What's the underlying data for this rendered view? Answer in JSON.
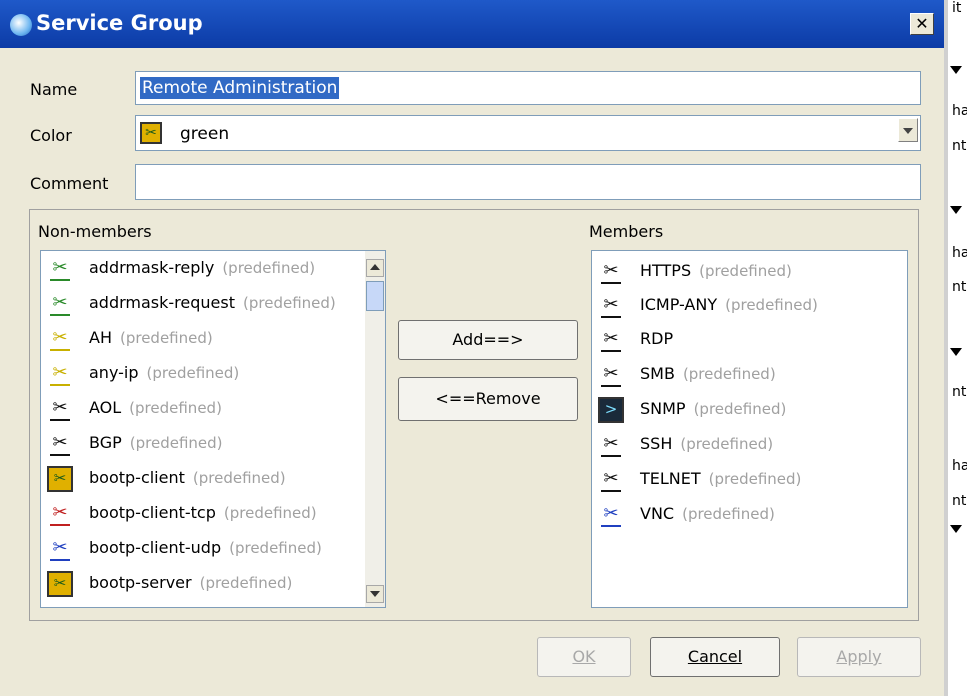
{
  "dialog": {
    "title": "Service Group",
    "close_label": "✕",
    "name_label": "Name",
    "name_value": "Remote Administration",
    "color_label": "Color",
    "color_value": "green",
    "comment_label": "Comment",
    "comment_value": ""
  },
  "non_members": {
    "label": "Non-members",
    "items": [
      {
        "name": "addrmask-reply",
        "tag": "(predefined)",
        "icon": "green-service-icon"
      },
      {
        "name": "addrmask-request",
        "tag": "(predefined)",
        "icon": "green-service-icon"
      },
      {
        "name": "AH",
        "tag": "(predefined)",
        "icon": "yellow-service-icon"
      },
      {
        "name": "any-ip",
        "tag": "(predefined)",
        "icon": "yellow-service-icon"
      },
      {
        "name": "AOL",
        "tag": "(predefined)",
        "icon": "black-service-icon"
      },
      {
        "name": "BGP",
        "tag": "(predefined)",
        "icon": "black-service-icon"
      },
      {
        "name": "bootp-client",
        "tag": "(predefined)",
        "icon": "boxed-service-icon"
      },
      {
        "name": "bootp-client-tcp",
        "tag": "(predefined)",
        "icon": "red-service-icon"
      },
      {
        "name": "bootp-client-udp",
        "tag": "(predefined)",
        "icon": "blue-service-icon"
      },
      {
        "name": "bootp-server",
        "tag": "(predefined)",
        "icon": "boxed-service-icon"
      }
    ]
  },
  "members": {
    "label": "Members",
    "items": [
      {
        "name": "HTTPS",
        "tag": "(predefined)",
        "icon": "black-service-icon"
      },
      {
        "name": "ICMP-ANY",
        "tag": "(predefined)",
        "icon": "black-service-icon"
      },
      {
        "name": "RDP",
        "tag": "",
        "icon": "black-service-icon"
      },
      {
        "name": "SMB",
        "tag": "(predefined)",
        "icon": "black-service-icon"
      },
      {
        "name": "SNMP",
        "tag": "(predefined)",
        "icon": "terminal-service-icon"
      },
      {
        "name": "SSH",
        "tag": "(predefined)",
        "icon": "black-service-icon"
      },
      {
        "name": "TELNET",
        "tag": "(predefined)",
        "icon": "black-service-icon"
      },
      {
        "name": "VNC",
        "tag": "(predefined)",
        "icon": "blue-service-icon"
      }
    ]
  },
  "buttons": {
    "add": "Add==>",
    "remove": "<==Remove",
    "ok": "OK",
    "cancel": "Cancel",
    "apply": "Apply"
  },
  "background_window": {
    "fragments": [
      "it",
      "ha",
      "nt",
      "ha",
      "nt",
      "nt",
      "ha",
      "nt"
    ]
  },
  "colors": {
    "titlebar": "#0c3ba6",
    "selection": "#316ac5",
    "dialog_bg": "#ece9d8"
  }
}
